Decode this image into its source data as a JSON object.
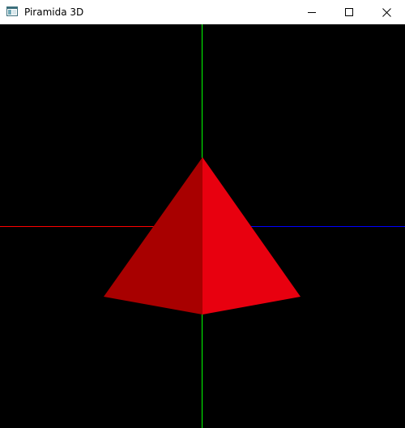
{
  "window": {
    "title": "Piramida 3D",
    "icon": "app-window-icon",
    "controls": {
      "minimize_icon": "minimize-icon",
      "maximize_icon": "maximize-icon",
      "close_icon": "close-icon"
    }
  },
  "scene": {
    "background_color": "#000000",
    "axes": {
      "x_color": "#ff0000",
      "y_color": "#00ff00",
      "z_color": "#0000ff"
    },
    "pyramid": {
      "left_face_color": "#a80000",
      "right_face_color": "#e8000f"
    }
  }
}
